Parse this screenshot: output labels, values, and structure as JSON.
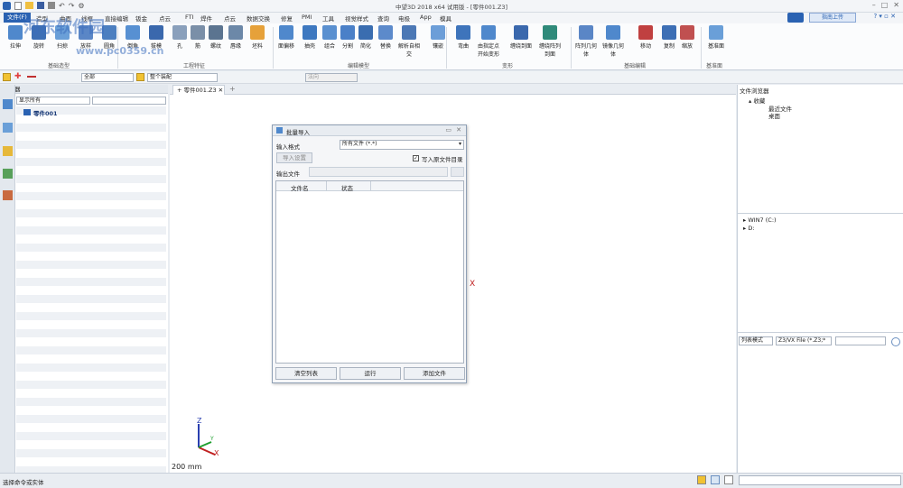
{
  "titlebar": {
    "title": "中望3D 2018 x64 试用版 - [零件001.Z3]",
    "quick_icons": [
      "new",
      "open",
      "save",
      "print",
      "undo",
      "redo",
      "settings",
      "dropdown"
    ]
  },
  "menubar": {
    "items": [
      "文件(F)",
      "造型",
      "曲面",
      "线框",
      "直接编辑",
      "钣金",
      "点云",
      "FTI",
      "焊件",
      "点云",
      "数据交换",
      "修复",
      "PMI",
      "工具",
      "视觉样式",
      "查询",
      "电极",
      "App",
      "模具"
    ],
    "active": "文件(F)",
    "cloud_button": "指南上传"
  },
  "ribbon": {
    "buttons": [
      "拉伸",
      "旋转",
      "扫掠",
      "放样",
      "圆角",
      "倒角",
      "拔模",
      "孔",
      "筋",
      "螺纹",
      "唇缘",
      "坯料",
      "面偏移",
      "抽壳",
      "组合",
      "分割",
      "简化",
      "替换",
      "解析自相交",
      "镶嵌",
      "弯曲",
      "由指定点开始变形",
      "缠绕到面",
      "缠绕阵列到面",
      "阵列几何体",
      "镜像几何体",
      "移动",
      "复制",
      "缩放",
      "基准面"
    ],
    "groups": [
      "基础造型",
      "工程特征",
      "编辑模型",
      "变形",
      "基础编辑",
      "基准面"
    ]
  },
  "toolbar2": {
    "filter_value": "全部",
    "scope_value": "整个装配",
    "direction": "法向"
  },
  "manager": {
    "title": "管理器",
    "filter": "显示所有",
    "root_item": "零件001"
  },
  "tabs": [
    {
      "label": "零件001.Z3"
    }
  ],
  "canvas": {
    "scale_label": "200 mm",
    "axis_x": "X",
    "axis_y": "Y",
    "axis_z": "Z"
  },
  "dialog": {
    "title": "批量导入",
    "input_format_label": "输入格式",
    "input_format_value": "所有文件 (*.*)",
    "import_settings": "导入设置",
    "write_source_label": "写入原文件目录",
    "output_label": "输出文件",
    "col_filename": "文件名",
    "col_status": "状态",
    "btn_clear": "清空列表",
    "btn_run": "运行",
    "btn_add": "添加文件"
  },
  "file_browser": {
    "title": "文件浏览器",
    "favorites": "收藏",
    "recent": "最近文件",
    "desktop": "桌面",
    "drive_c": "WIN7 (C:)",
    "drive_d": "D:",
    "view_mode": "列表模式",
    "file_filter": "Z3/VX File (*.Z3;*"
  },
  "status": {
    "text": "选择命令或实体"
  },
  "watermark": {
    "line1": "河东软件园",
    "line2": "www.pc0359.cn"
  },
  "colors": {
    "accent": "#2a62b2",
    "ribbon_bg": "#fbfcfd",
    "panel_bg": "#e9edf2"
  }
}
